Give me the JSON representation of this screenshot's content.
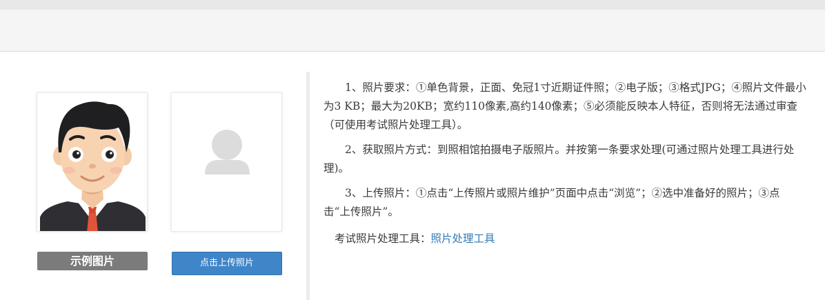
{
  "sample": {
    "caption": "示例图片",
    "icon": "sample-person-portrait"
  },
  "upload": {
    "placeholder_icon": "user-silhouette-icon",
    "button_label": "点击上传照片"
  },
  "instructions": {
    "items": [
      "1、照片要求：①单色背景，正面、免冠1寸近期证件照；②电子版；③格式JPG；④照片文件最小为3 KB；最大为20KB；宽约110像素,高约140像素；⑤必须能反映本人特征，否则将无法通过审查（可使用考试照片处理工具）。",
      "2、获取照片方式：到照相馆拍摄电子版照片。并按第一条要求处理(可通过照片处理工具进行处理)。",
      "3、上传照片：①点击“上传照片或照片维护”页面中点击“浏览”；②选中准备好的照片；③点击“上传照片”。"
    ],
    "tool_label": "考试照片处理工具：",
    "tool_link": "照片处理工具"
  },
  "colors": {
    "button_blue": "#3f86c9",
    "caption_gray": "#7b7b7b",
    "link_blue": "#3079b5"
  }
}
